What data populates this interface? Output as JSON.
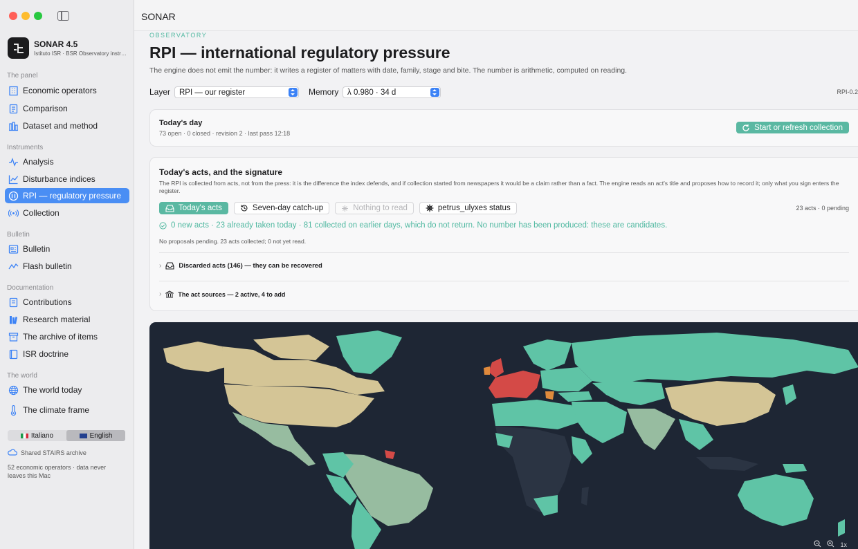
{
  "app": {
    "name": "SONAR 4.5",
    "subtitle": "Istituto ISR · BSR Observatory instr…",
    "window_title": "SONAR"
  },
  "sidebar": {
    "sections": [
      {
        "label": "The panel",
        "items": [
          {
            "label": "Economic operators",
            "icon": "building-icon"
          },
          {
            "label": "Comparison",
            "icon": "document-icon"
          },
          {
            "label": "Dataset and method",
            "icon": "columns-icon"
          }
        ]
      },
      {
        "label": "Instruments",
        "items": [
          {
            "label": "Analysis",
            "icon": "waveform-icon"
          },
          {
            "label": "Disturbance indices",
            "icon": "line-chart-icon"
          },
          {
            "label": "RPI — regulatory pressure",
            "icon": "gauge-icon",
            "active": true
          },
          {
            "label": "Collection",
            "icon": "broadcast-icon"
          }
        ]
      },
      {
        "label": "Bulletin",
        "items": [
          {
            "label": "Bulletin",
            "icon": "newspaper-icon"
          },
          {
            "label": "Flash bulletin",
            "icon": "wave-icon"
          }
        ]
      },
      {
        "label": "Documentation",
        "items": [
          {
            "label": "Contributions",
            "icon": "book-icon"
          },
          {
            "label": "Research material",
            "icon": "books-icon"
          },
          {
            "label": "The archive of items",
            "icon": "archive-icon"
          },
          {
            "label": "ISR doctrine",
            "icon": "doctrine-icon"
          }
        ]
      },
      {
        "label": "The world",
        "items": [
          {
            "label": "The world today",
            "icon": "globe-icon"
          },
          {
            "label": "The climate frame",
            "icon": "thermometer-icon"
          }
        ]
      }
    ],
    "languages": [
      {
        "label": "Italiano",
        "selected": false
      },
      {
        "label": "English",
        "selected": true
      }
    ],
    "shared_archive": "Shared STAIRS archive",
    "footer": "52 economic operators · data never leaves this Mac"
  },
  "page": {
    "eyebrow": "OBSERVATORY",
    "title": "RPI — international regulatory pressure",
    "subtitle": "The engine does not emit the number: it writes a register of matters with date, family, stage and bite. The number is arithmetic, computed on reading.",
    "layer_label": "Layer",
    "layer_value": "RPI — our register",
    "memory_label": "Memory",
    "memory_value": "λ 0.980 · 34 d",
    "version": "RPI-0.2"
  },
  "today": {
    "title": "Today's day",
    "stats": "73 open · 0 closed · revision 2 · last pass 12:18",
    "refresh_label": "Start or refresh collection"
  },
  "acts": {
    "title": "Today's acts, and the signature",
    "description": "The RPI is collected from acts, not from the press: it is the difference the index defends, and if collection started from newspapers it would be a claim rather than a fact. The engine reads an act's title and proposes how to record it; only what you sign enters the register.",
    "tabs": [
      {
        "label": "Today's acts",
        "state": "active"
      },
      {
        "label": "Seven-day catch-up",
        "state": "normal"
      },
      {
        "label": "Nothing to read",
        "state": "disabled"
      },
      {
        "label": "petrus_ulyxes status",
        "state": "normal"
      }
    ],
    "count": "23 acts · 0 pending",
    "status": "0 new acts · 23 already taken today · 81 collected on earlier days, which do not return. No number has been produced: these are candidates.",
    "note": "No proposals pending. 23 acts collected; 0 not yet read.",
    "discarded": "Discarded acts (146) — they can be recovered",
    "sources": "The act sources — 2 active, 4 to add"
  },
  "map": {
    "zoom_level": "1x",
    "colors": {
      "ocean": "#1e2634",
      "low": "#5fc4a6",
      "medium": "#d4c596",
      "high": "#d44a47",
      "elevated": "#e08a3c",
      "none": "#2b3443",
      "neutral": "#97bca0"
    }
  }
}
